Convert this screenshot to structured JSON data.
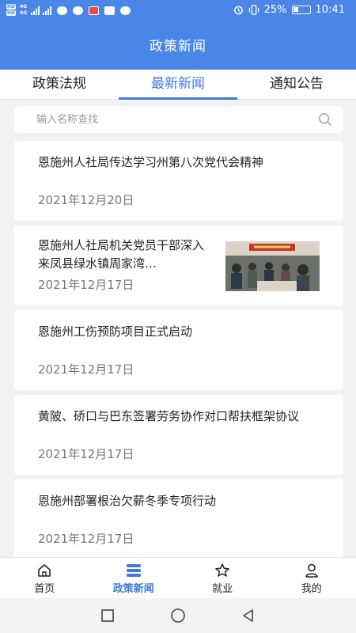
{
  "status_bar": {
    "sim_labels": [
      "HD",
      "HD"
    ],
    "network_labels": [
      "4G",
      "4G"
    ],
    "battery": "25%",
    "time": "10:41"
  },
  "header": {
    "title": "政策新闻"
  },
  "tabs": [
    {
      "label": "政策法规",
      "active": false
    },
    {
      "label": "最新新闻",
      "active": true
    },
    {
      "label": "通知公告",
      "active": false
    }
  ],
  "search": {
    "placeholder": "输入名称查找",
    "value": ""
  },
  "news": [
    {
      "title": "恩施州人社局传达学习州第八次党代会精神",
      "date": "2021年12月20日"
    },
    {
      "title": "恩施州人社局机关党员干部深入来凤县绿水镇周家湾…",
      "date": "2021年12月17日",
      "has_image": true
    },
    {
      "title": "恩施州工伤预防项目正式启动",
      "date": "2021年12月17日"
    },
    {
      "title": "黄陂、硚口与巴东签署劳务协作对口帮扶框架协议",
      "date": "2021年12月17日"
    },
    {
      "title": "恩施州部署根治欠薪冬季专项行动",
      "date": "2021年12月17日"
    }
  ],
  "bottom_nav": [
    {
      "label": "首页",
      "icon": "home-icon",
      "active": false
    },
    {
      "label": "政策新闻",
      "icon": "news-stack-icon",
      "active": true
    },
    {
      "label": "就业",
      "icon": "star-icon",
      "active": false
    },
    {
      "label": "我的",
      "icon": "person-icon",
      "active": false
    }
  ],
  "colors": {
    "primary": "#4a86e8",
    "active_text": "#3e7bdb"
  }
}
